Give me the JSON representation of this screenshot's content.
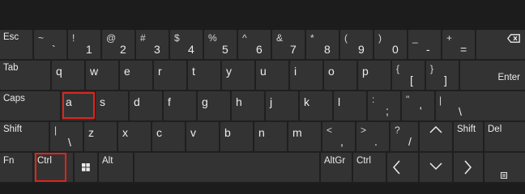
{
  "rows": [
    {
      "keys": [
        {
          "id": "esc",
          "label": "Esc"
        },
        {
          "id": "backtick",
          "main": "`",
          "shift": "~"
        },
        {
          "id": "1",
          "main": "1",
          "shift": "!"
        },
        {
          "id": "2",
          "main": "2",
          "shift": "@"
        },
        {
          "id": "3",
          "main": "3",
          "shift": "#"
        },
        {
          "id": "4",
          "main": "4",
          "shift": "$"
        },
        {
          "id": "5",
          "main": "5",
          "shift": "%"
        },
        {
          "id": "6",
          "main": "6",
          "shift": "^"
        },
        {
          "id": "7",
          "main": "7",
          "shift": "&"
        },
        {
          "id": "8",
          "main": "8",
          "shift": "*"
        },
        {
          "id": "9",
          "main": "9",
          "shift": "("
        },
        {
          "id": "0",
          "main": "0",
          "shift": ")"
        },
        {
          "id": "minus",
          "main": "-",
          "shift": "_"
        },
        {
          "id": "equals",
          "main": "=",
          "shift": "+"
        },
        {
          "id": "backspace",
          "icon": "backspace-icon"
        }
      ]
    },
    {
      "keys": [
        {
          "id": "tab",
          "label": "Tab"
        },
        {
          "id": "q",
          "main": "q"
        },
        {
          "id": "w",
          "main": "w"
        },
        {
          "id": "e",
          "main": "e"
        },
        {
          "id": "r",
          "main": "r"
        },
        {
          "id": "t",
          "main": "t"
        },
        {
          "id": "y",
          "main": "y"
        },
        {
          "id": "u",
          "main": "u"
        },
        {
          "id": "i",
          "main": "i"
        },
        {
          "id": "o",
          "main": "o"
        },
        {
          "id": "p",
          "main": "p"
        },
        {
          "id": "lbracket",
          "main": "[",
          "shift": "{"
        },
        {
          "id": "rbracket",
          "main": "]",
          "shift": "}"
        },
        {
          "id": "enter",
          "label": "Enter"
        }
      ]
    },
    {
      "keys": [
        {
          "id": "caps",
          "label": "Caps"
        },
        {
          "id": "a",
          "main": "a"
        },
        {
          "id": "s",
          "main": "s"
        },
        {
          "id": "d",
          "main": "d"
        },
        {
          "id": "f",
          "main": "f"
        },
        {
          "id": "g",
          "main": "g"
        },
        {
          "id": "h",
          "main": "h"
        },
        {
          "id": "j",
          "main": "j"
        },
        {
          "id": "k",
          "main": "k"
        },
        {
          "id": "l",
          "main": "l"
        },
        {
          "id": "semicolon",
          "main": ";",
          "shift": ":"
        },
        {
          "id": "quote",
          "main": "'",
          "shift": "\""
        },
        {
          "id": "backslash",
          "main": "\\",
          "shift": "|"
        }
      ]
    },
    {
      "keys": [
        {
          "id": "shift-left",
          "label": "Shift"
        },
        {
          "id": "oem102",
          "main": "\\",
          "shift": "|"
        },
        {
          "id": "z",
          "main": "z"
        },
        {
          "id": "x",
          "main": "x"
        },
        {
          "id": "c",
          "main": "c"
        },
        {
          "id": "v",
          "main": "v"
        },
        {
          "id": "b",
          "main": "b"
        },
        {
          "id": "n",
          "main": "n"
        },
        {
          "id": "m",
          "main": "m"
        },
        {
          "id": "comma",
          "main": ",",
          "shift": "<"
        },
        {
          "id": "period",
          "main": ".",
          "shift": ">"
        },
        {
          "id": "slash",
          "main": "/",
          "shift": "?"
        },
        {
          "id": "up",
          "icon": "arrow-up-icon"
        },
        {
          "id": "shift-right",
          "label": "Shift"
        },
        {
          "id": "del",
          "label": "Del"
        }
      ]
    },
    {
      "keys": [
        {
          "id": "fn",
          "label": "Fn"
        },
        {
          "id": "ctrl-left",
          "label": "Ctrl"
        },
        {
          "id": "win",
          "icon": "windows-icon"
        },
        {
          "id": "alt",
          "label": "Alt"
        },
        {
          "id": "space",
          "label": ""
        },
        {
          "id": "altgr",
          "label": "AltGr"
        },
        {
          "id": "ctrl-right",
          "label": "Ctrl"
        },
        {
          "id": "left",
          "icon": "arrow-left-icon"
        },
        {
          "id": "down",
          "icon": "arrow-down-icon"
        },
        {
          "id": "right",
          "icon": "arrow-right-icon"
        },
        {
          "id": "menu",
          "icon": "menu-icon"
        }
      ]
    }
  ],
  "highlighted_keys": [
    "a",
    "ctrl-left"
  ],
  "colors": {
    "background": "#1f1f1f",
    "key": "#333333",
    "text": "#ececec",
    "highlight": "#e2231a"
  }
}
